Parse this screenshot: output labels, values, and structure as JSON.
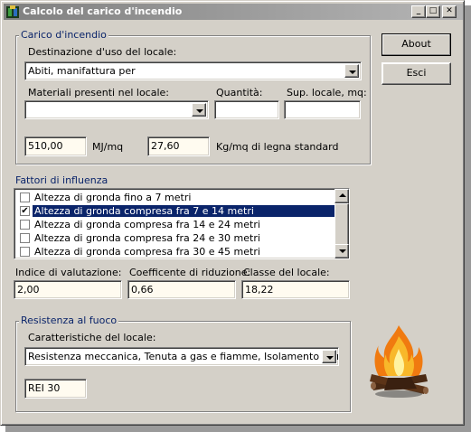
{
  "window": {
    "title": "Calcolo del carico d'incendio",
    "minimize": "_",
    "maximize": "□",
    "close": "✕"
  },
  "carico": {
    "caption": "Carico d'incendio",
    "destinazione_label": "Destinazione d'uso del locale:",
    "destinazione_value": "Abiti, manifattura per",
    "materiali_label": "Materiali presenti nel locale:",
    "materiali_value": "",
    "quantita_label": "Quantità:",
    "quantita_value": "",
    "superficie_label": "Sup. locale, mq:",
    "superficie_value": "",
    "mj_value": "510,00",
    "mj_unit": "MJ/mq",
    "kg_value": "27,60",
    "kg_unit": "Kg/mq di legna standard"
  },
  "fattori": {
    "caption": "Fattori di influenza",
    "items": [
      {
        "label": "Altezza di gronda fino a 7 metri",
        "checked": false
      },
      {
        "label": "Altezza di gronda compresa fra 7 e 14 metri",
        "checked": true
      },
      {
        "label": "Altezza di gronda compresa fra 14 e 24 metri",
        "checked": false
      },
      {
        "label": "Altezza di gronda compresa fra 24 e 30 metri",
        "checked": false
      },
      {
        "label": "Altezza di gronda compresa fra 30 e 45 metri",
        "checked": false
      }
    ],
    "check_mark": "✔"
  },
  "valutazione": {
    "indice_label": "Indice di valutazione:",
    "indice_value": "2,00",
    "coeff_label": "Coefficente di riduzione:",
    "coeff_value": "0,66",
    "classe_label": "Classe del locale:",
    "classe_value": "18,22"
  },
  "resistenza": {
    "caption": "Resistenza al fuoco",
    "caratteristiche_label": "Caratteristiche del locale:",
    "caratteristiche_value": "Resistenza meccanica, Tenuta a gas e fiamme, Isolamento termico",
    "rei_value": "REI 30"
  },
  "buttons": {
    "about": "About",
    "esci": "Esci"
  },
  "colors": {
    "face": "#d4d0c8",
    "caption_text": "#0a246a",
    "selection": "#0a246a",
    "readonly_bg": "#fffbf0"
  },
  "icons": {
    "campfire": "campfire-icon",
    "app": "app-icon"
  }
}
